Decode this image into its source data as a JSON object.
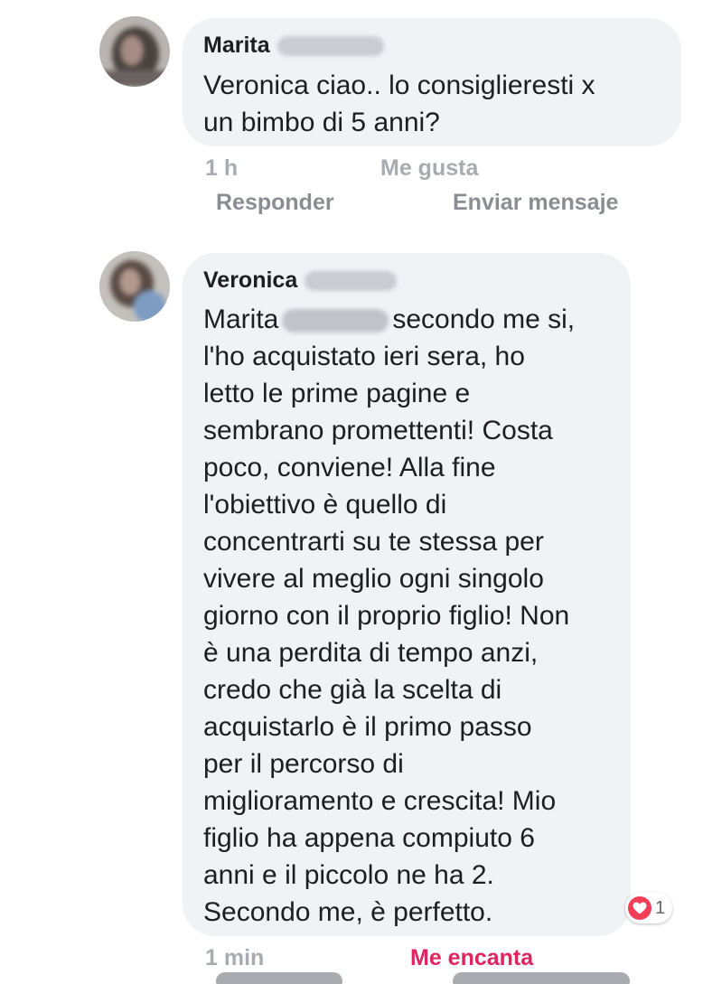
{
  "comments": [
    {
      "author": "Marita",
      "text_lines": [
        "Veronica ciao.. lo consiglieresti x",
        "un bimbo di 5 anni?"
      ],
      "timestamp": "1 h",
      "like_label": "Me gusta",
      "reply_label": "Responder",
      "message_label": "Enviar mensaje"
    },
    {
      "author": "Veronica",
      "mention_first_name": "Marita",
      "first_line_rest": "secondo me si,",
      "text_lines": [
        "l'ho acquistato ieri sera, ho",
        "letto le prime pagine e",
        "sembrano promettenti! Costa",
        "poco, conviene! Alla fine",
        "l'obiettivo è quello di",
        "concentrarti su te stessa per",
        "vivere al meglio ogni singolo",
        "giorno con il proprio figlio! Non",
        "è una perdita di tempo anzi,",
        "credo che già la scelta di",
        "acquistarlo è il primo passo",
        "per il percorso di",
        "miglioramento e crescita! Mio",
        "figlio ha appena compiuto 6",
        "anni e il piccolo ne ha 2.",
        "Secondo me, è perfetto."
      ],
      "reaction_count": "1",
      "reaction_icon": "heart-icon",
      "timestamp": "1 min",
      "reaction_label": "Me encanta"
    }
  ],
  "colors": {
    "bubble": "#f0f2f5",
    "meta_text": "#8a8d91",
    "love": "#e0245e",
    "heart_badge": "#f33e58"
  }
}
